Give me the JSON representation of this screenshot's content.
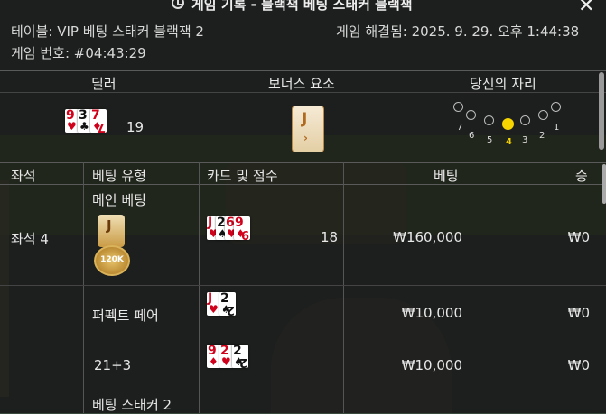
{
  "window": {
    "title": "게임 기록 - 블랙잭 베팅 스태커 블랙잭",
    "close_icon": "close-icon",
    "history_icon": "history-icon"
  },
  "meta": {
    "table": "테이블: VIP 베팅 스태커 블랙잭 2",
    "resolved": "게임 해결됨: 2025. 9. 29. 오후 1:44:38",
    "game_no": "게임 번호: #04:43:29"
  },
  "summary": {
    "dealer_label": "딜러",
    "bonus_label": "보너스 요소",
    "seat_label": "당신의 자리",
    "dealer_cards": [
      {
        "rank": "9",
        "suit": "♥",
        "color": "red"
      },
      {
        "rank": "3",
        "suit": "♣",
        "color": "black"
      },
      {
        "rank": "7",
        "suit": "♦",
        "color": "red"
      }
    ],
    "dealer_score": "19",
    "bonus_card": "J",
    "seats": [
      "7",
      "6",
      "5",
      "4",
      "3",
      "2",
      "1"
    ],
    "active_seat": "4"
  },
  "table": {
    "headers": [
      "좌석",
      "베팅 유형",
      "카드 및 점수",
      "베팅",
      "승"
    ],
    "seat_label": "좌석 4",
    "rows": [
      {
        "type": "메인 베팅",
        "chip_card": "J",
        "chip_label": "120K",
        "cards": [
          {
            "rank": "J",
            "suit": "♥",
            "color": "red"
          },
          {
            "rank": "2",
            "suit": "♠",
            "color": "black"
          },
          {
            "rank": "6",
            "suit": "♥",
            "color": "red"
          },
          {
            "rank": "9",
            "suit": "♦",
            "color": "red"
          }
        ],
        "score": "18",
        "bet": "₩160,000",
        "win": "₩0"
      },
      {
        "type": "퍼펙트 페어",
        "cards": [
          {
            "rank": "J",
            "suit": "♥",
            "color": "red"
          },
          {
            "rank": "2",
            "suit": "♠",
            "color": "black"
          }
        ],
        "score": "",
        "bet": "₩10,000",
        "win": "₩0"
      },
      {
        "type": "21+3",
        "cards": [
          {
            "rank": "9",
            "suit": "♦",
            "color": "red"
          },
          {
            "rank": "2",
            "suit": "♥",
            "color": "red"
          },
          {
            "rank": "2",
            "suit": "♠",
            "color": "black"
          }
        ],
        "score": "",
        "bet": "₩10,000",
        "win": "₩0"
      },
      {
        "type": "베팅 스태커 2",
        "cards": [],
        "score": "",
        "bet": "",
        "win": ""
      }
    ]
  }
}
